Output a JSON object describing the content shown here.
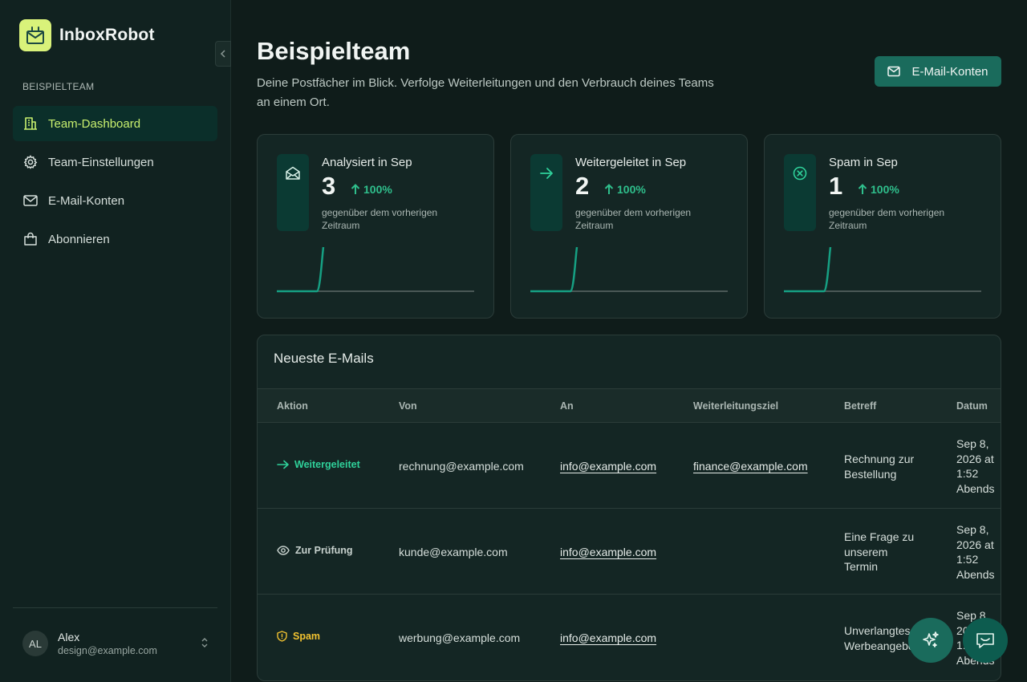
{
  "app": {
    "name": "InboxRobot"
  },
  "sidebar": {
    "section_label": "BEISPIELTEAM",
    "items": [
      {
        "label": "Team-Dashboard",
        "icon": "building-icon",
        "active": true
      },
      {
        "label": "Team-Einstellungen",
        "icon": "gear-icon",
        "active": false
      },
      {
        "label": "E-Mail-Konten",
        "icon": "mail-icon",
        "active": false
      },
      {
        "label": "Abonnieren",
        "icon": "shopping-bag-icon",
        "active": false
      }
    ],
    "user": {
      "initials": "AL",
      "name": "Alex",
      "email": "design@example.com"
    }
  },
  "header": {
    "title": "Beispielteam",
    "description": "Deine Postfächer im Blick. Verfolge Weiterleitungen und den Verbrauch deines Teams an einem Ort.",
    "accounts_button": "E-Mail-Konten"
  },
  "stats": [
    {
      "label": "Analysiert in Sep",
      "value": "3",
      "change": "100%",
      "sub": "gegenüber dem vorherigen Zeitraum",
      "icon": "mail-open-icon"
    },
    {
      "label": "Weitergeleitet in Sep",
      "value": "2",
      "change": "100%",
      "sub": "gegenüber dem vorherigen Zeitraum",
      "icon": "arrow-right-icon"
    },
    {
      "label": "Spam in Sep",
      "value": "1",
      "change": "100%",
      "sub": "gegenüber dem vorherigen Zeitraum",
      "icon": "x-circle-icon"
    }
  ],
  "emails": {
    "title": "Neueste E-Mails",
    "columns": [
      "Aktion",
      "Von",
      "An",
      "Weiterleitungsziel",
      "Betreff",
      "Datum"
    ],
    "rows": [
      {
        "action": "Weitergeleitet",
        "from": "rechnung@example.com",
        "to": "info@example.com",
        "target": "finance@example.com",
        "subject": "Rechnung zur Bestellung",
        "date": "Sep 8, 2026 at 1:52 Abends"
      },
      {
        "action": "Zur Prüfung",
        "from": "kunde@example.com",
        "to": "info@example.com",
        "target": "",
        "subject": "Eine Frage zu unserem Termin",
        "date": "Sep 8, 2026 at 1:52 Abends"
      },
      {
        "action": "Spam",
        "from": "werbung@example.com",
        "to": "info@example.com",
        "target": "",
        "subject": "Unverlangtes Werbeangebot",
        "date": "Sep 8, 2026 at 1:52 Abends"
      }
    ]
  },
  "colors": {
    "accent": "#1a6b5c",
    "forwarded": "#2fd19a",
    "review": "#c8d2ce",
    "spam": "#f2c230",
    "active_nav": "#c9f06e"
  }
}
